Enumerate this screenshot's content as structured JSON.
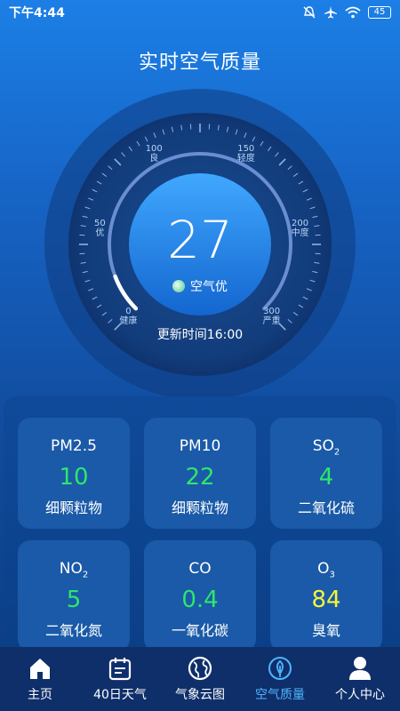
{
  "status_bar": {
    "time": "下午4:44",
    "battery": "45"
  },
  "title": "实时空气质量",
  "gauge": {
    "aqi": "27",
    "status": "空气优",
    "update_time": "更新时间16:00",
    "ticks": [
      {
        "num": "0",
        "label": "健康"
      },
      {
        "num": "50",
        "label": "优"
      },
      {
        "num": "100",
        "label": "良"
      },
      {
        "num": "150",
        "label": "轻度"
      },
      {
        "num": "200",
        "label": "中度"
      },
      {
        "num": "300",
        "label": "严重"
      }
    ],
    "progress_fraction": 0.09
  },
  "pollutants": [
    {
      "name": "PM2.5",
      "sub": "",
      "value": "10",
      "desc": "细颗粒物",
      "color": "#2ee66b"
    },
    {
      "name": "PM10",
      "sub": "",
      "value": "22",
      "desc": "细颗粒物",
      "color": "#2ee66b"
    },
    {
      "name": "SO",
      "sub": "2",
      "value": "4",
      "desc": "二氧化硫",
      "color": "#2ee66b"
    },
    {
      "name": "NO",
      "sub": "2",
      "value": "5",
      "desc": "二氧化氮",
      "color": "#2ee66b"
    },
    {
      "name": "CO",
      "sub": "",
      "value": "0.4",
      "desc": "一氧化碳",
      "color": "#2ee66b"
    },
    {
      "name": "O",
      "sub": "3",
      "value": "84",
      "desc": "臭氧",
      "color": "#f5f53a"
    }
  ],
  "nav": {
    "items": [
      {
        "label": "主页",
        "icon": "home-icon"
      },
      {
        "label": "40日天气",
        "icon": "calendar-icon"
      },
      {
        "label": "气象云图",
        "icon": "globe-icon"
      },
      {
        "label": "空气质量",
        "icon": "leaf-icon"
      },
      {
        "label": "个人中心",
        "icon": "person-icon"
      }
    ],
    "active_index": 3,
    "active_color": "#4fb5ff"
  }
}
